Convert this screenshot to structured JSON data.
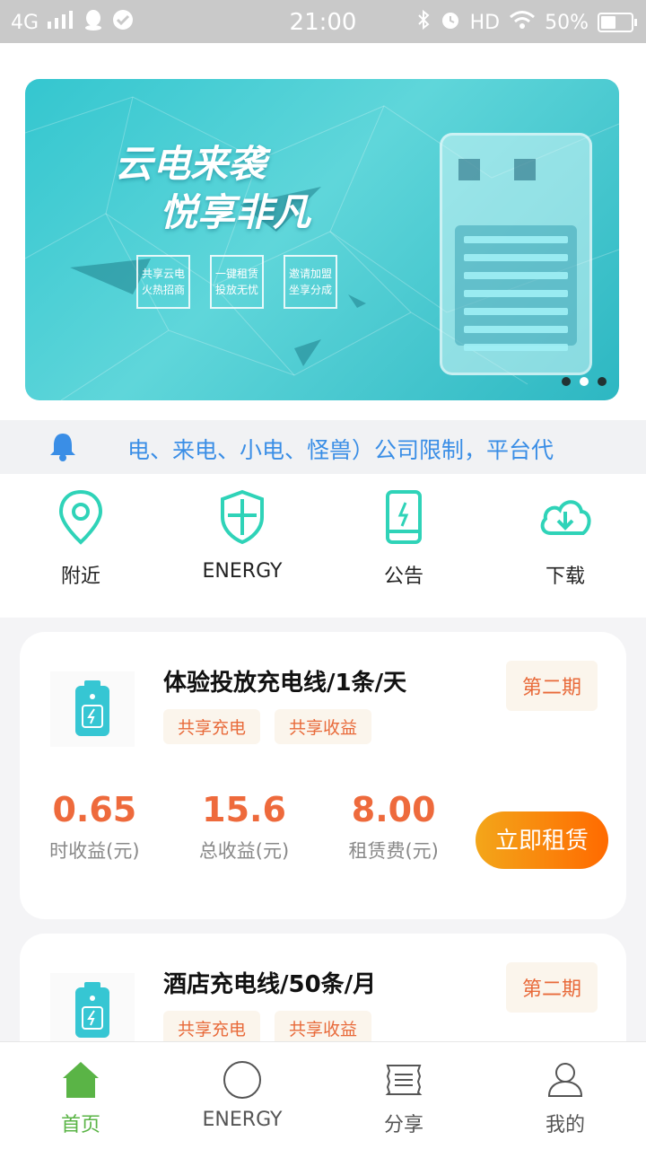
{
  "status_bar": {
    "network": "4G",
    "time": "21:00",
    "hd": "HD",
    "battery": "50%",
    "battery_level": 0.5
  },
  "banner": {
    "headline_line1": "云电来袭",
    "headline_line2": "悦享非凡",
    "tags": [
      {
        "line1": "共享云电",
        "line2": "火热招商"
      },
      {
        "line1": "一键租赁",
        "line2": "投放无忧"
      },
      {
        "line1": "邀请加盟",
        "line2": "坐享分成"
      }
    ],
    "slide_count": 3,
    "active_slide": 2
  },
  "notice": {
    "text": "电、来电、小电、怪兽）公司限制，平台代"
  },
  "quick_nav": [
    {
      "label": "附近",
      "icon": "location-pin-icon"
    },
    {
      "label": "ENERGY",
      "icon": "shield-icon"
    },
    {
      "label": "公告",
      "icon": "phone-icon"
    },
    {
      "label": "下载",
      "icon": "cloud-download-icon"
    }
  ],
  "products": [
    {
      "title": "体验投放充电线/1条/天",
      "tags": [
        "共享充电",
        "共享收益"
      ],
      "period": "第二期",
      "stats": [
        {
          "value": "0.65",
          "label": "时收益(元)"
        },
        {
          "value": "15.6",
          "label": "总收益(元)"
        },
        {
          "value": "8.00",
          "label": "租赁费(元)"
        }
      ],
      "button": "立即租赁"
    },
    {
      "title": "酒店充电线/50条/月",
      "tags": [
        "共享充电",
        "共享收益"
      ],
      "period": "第二期"
    }
  ],
  "bottom_nav": [
    {
      "label": "首页",
      "icon": "home-icon",
      "active": true
    },
    {
      "label": "ENERGY",
      "icon": "circle-icon",
      "active": false
    },
    {
      "label": "分享",
      "icon": "share-icon",
      "active": false
    },
    {
      "label": "我的",
      "icon": "profile-icon",
      "active": false
    }
  ],
  "colors": {
    "accent_teal": "#2fd3b8",
    "accent_orange": "#ff6a00",
    "tag_text": "#e86a3a",
    "notice_blue": "#3a8ee6",
    "active_green": "#5ab446"
  }
}
